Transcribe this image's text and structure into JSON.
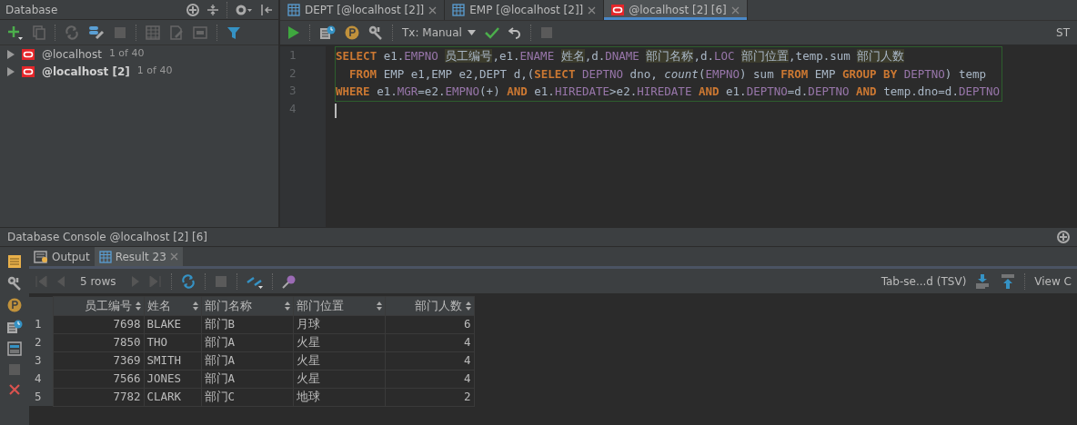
{
  "database_panel": {
    "title": "Database",
    "tree": [
      {
        "label": "@localhost",
        "count": "1 of 40",
        "active": false
      },
      {
        "label": "@localhost [2]",
        "count": "1 of 40",
        "active": true
      }
    ]
  },
  "editor": {
    "tabs": [
      {
        "label": "DEPT [@localhost [2]]",
        "kind": "table",
        "selected": false
      },
      {
        "label": "EMP [@localhost [2]]",
        "kind": "table",
        "selected": false
      },
      {
        "label": "@localhost [2] [6]",
        "kind": "console",
        "selected": true
      }
    ],
    "tx_mode": "Tx: Manual",
    "toolbar_edge_text": "ST",
    "lines": [
      {
        "number": "1",
        "tokens": [
          {
            "text": "SELECT",
            "kind": "keyword"
          },
          {
            "text": " e1.",
            "kind": "plain"
          },
          {
            "text": "EMPNO",
            "kind": "field"
          },
          {
            "text": "员工编号",
            "kind": "alias",
            "gap_before": true
          },
          {
            "text": ",e1.",
            "kind": "plain"
          },
          {
            "text": "ENAME",
            "kind": "field"
          },
          {
            "text": "姓名",
            "kind": "alias",
            "gap_before": true
          },
          {
            "text": ",d.",
            "kind": "plain"
          },
          {
            "text": "DNAME",
            "kind": "field"
          },
          {
            "text": "部门名称",
            "kind": "alias",
            "gap_before": true
          },
          {
            "text": ",d.",
            "kind": "plain"
          },
          {
            "text": "LOC",
            "kind": "field"
          },
          {
            "text": "部门位置",
            "kind": "alias",
            "gap_before": true
          },
          {
            "text": ",temp.sum ",
            "kind": "plain"
          },
          {
            "text": "部门人数",
            "kind": "alias"
          }
        ]
      },
      {
        "number": "2",
        "indent": true,
        "tokens": [
          {
            "text": "FROM",
            "kind": "keyword"
          },
          {
            "text": " EMP e1,EMP e2,DEPT d,(",
            "kind": "plain"
          },
          {
            "text": "SELECT",
            "kind": "keyword"
          },
          {
            "text": "DEPTNO",
            "kind": "field",
            "gap_before": true
          },
          {
            "text": " dno, ",
            "kind": "plain"
          },
          {
            "text": "count",
            "kind": "function"
          },
          {
            "text": "(",
            "kind": "plain"
          },
          {
            "text": "EMPNO",
            "kind": "field"
          },
          {
            "text": ") sum ",
            "kind": "plain"
          },
          {
            "text": "FROM",
            "kind": "keyword"
          },
          {
            "text": " EMP ",
            "kind": "plain"
          },
          {
            "text": "GROUP BY",
            "kind": "keyword"
          },
          {
            "text": "DEPTNO",
            "kind": "field",
            "gap_before": true
          },
          {
            "text": ") temp",
            "kind": "plain"
          }
        ]
      },
      {
        "number": "3",
        "tokens": [
          {
            "text": "WHERE",
            "kind": "keyword"
          },
          {
            "text": " e1.",
            "kind": "plain"
          },
          {
            "text": "MGR",
            "kind": "field"
          },
          {
            "text": "=e2.",
            "kind": "plain"
          },
          {
            "text": "EMPNO",
            "kind": "field"
          },
          {
            "text": "(+) ",
            "kind": "plain"
          },
          {
            "text": "AND",
            "kind": "keyword"
          },
          {
            "text": " e1.",
            "kind": "plain"
          },
          {
            "text": "HIREDATE",
            "kind": "field"
          },
          {
            "text": ">e2.",
            "kind": "plain"
          },
          {
            "text": "HIREDATE",
            "kind": "field"
          },
          {
            "text": "AND",
            "kind": "keyword",
            "gap_before": true
          },
          {
            "text": " e1.",
            "kind": "plain"
          },
          {
            "text": "DEPTNO",
            "kind": "field"
          },
          {
            "text": "=d.",
            "kind": "plain"
          },
          {
            "text": "DEPTNO",
            "kind": "field"
          },
          {
            "text": "AND",
            "kind": "keyword",
            "gap_before": true
          },
          {
            "text": " temp.dno=d.",
            "kind": "plain"
          },
          {
            "text": "DEPTNO",
            "kind": "field"
          }
        ]
      },
      {
        "number": "4"
      }
    ]
  },
  "console": {
    "title": "Database Console @localhost [2] [6]",
    "tabs": [
      {
        "label": "Output",
        "kind": "output",
        "selected": false,
        "closable": false
      },
      {
        "label": "Result 23",
        "kind": "table",
        "selected": true,
        "closable": true
      }
    ],
    "row_count": "5 rows",
    "export_format": "Tab-se...d (TSV)",
    "edge_text": "View C",
    "table": {
      "columns": [
        {
          "label": "员工编号",
          "numeric": true
        },
        {
          "label": "姓名",
          "numeric": false
        },
        {
          "label": "部门名称",
          "numeric": false
        },
        {
          "label": "部门位置",
          "numeric": false
        },
        {
          "label": "部门人数",
          "numeric": true
        }
      ],
      "rows": [
        {
          "number": "1",
          "cells": [
            "7698",
            "BLAKE",
            "部门B",
            "月球",
            "6"
          ]
        },
        {
          "number": "2",
          "cells": [
            "7850",
            "THO",
            "部门A",
            "火星",
            "4"
          ]
        },
        {
          "number": "3",
          "cells": [
            "7369",
            "SMITH",
            "部门A",
            "火星",
            "4"
          ]
        },
        {
          "number": "4",
          "cells": [
            "7566",
            "JONES",
            "部门A",
            "火星",
            "4"
          ]
        },
        {
          "number": "5",
          "cells": [
            "7782",
            "CLARK",
            "部门C",
            "地球",
            "2"
          ]
        }
      ]
    }
  }
}
